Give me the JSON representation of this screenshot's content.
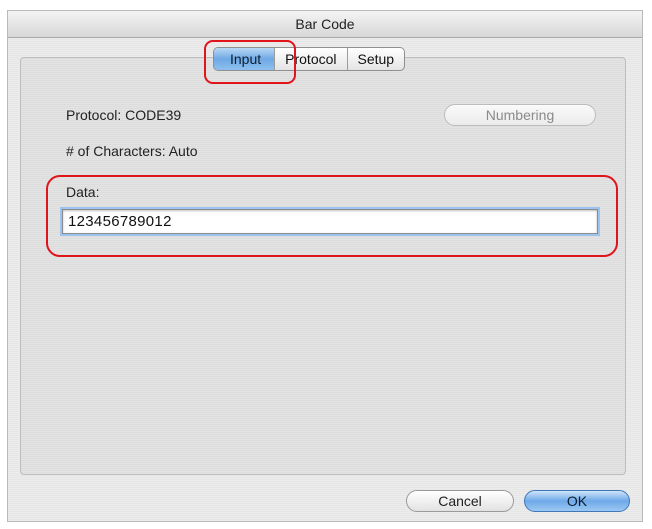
{
  "window": {
    "title": "Bar Code"
  },
  "tabs": [
    {
      "label": "Input",
      "active": true
    },
    {
      "label": "Protocol",
      "active": false
    },
    {
      "label": "Setup",
      "active": false
    }
  ],
  "input_panel": {
    "protocol_label": "Protocol: CODE39",
    "characters_label": "# of Characters: Auto",
    "numbering_button": "Numbering",
    "data_label": "Data:",
    "data_value": "123456789012"
  },
  "footer": {
    "cancel_label": "Cancel",
    "ok_label": "OK"
  },
  "colors": {
    "highlight": "#e0141b",
    "accent": "#6fa9e4"
  }
}
